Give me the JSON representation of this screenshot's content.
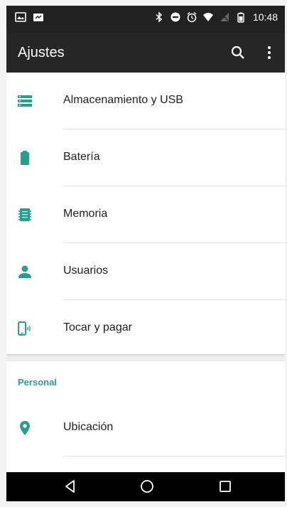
{
  "status_bar": {
    "time": "10:48",
    "left_icons": [
      "gallery-icon",
      "photo-icon"
    ],
    "right_icons": [
      "bluetooth-icon",
      "do-not-disturb-icon",
      "alarm-icon",
      "wifi-icon",
      "no-signal-icon",
      "battery-icon"
    ]
  },
  "toolbar": {
    "title": "Ajustes",
    "search_icon": "search-icon",
    "more_icon": "more-vert-icon"
  },
  "device_section": {
    "items": [
      {
        "label": "Almacenamiento y USB",
        "icon": "storage-icon"
      },
      {
        "label": "Batería",
        "icon": "battery-icon"
      },
      {
        "label": "Memoria",
        "icon": "memory-icon"
      },
      {
        "label": "Usuarios",
        "icon": "person-icon"
      },
      {
        "label": "Tocar y pagar",
        "icon": "nfc-icon"
      }
    ]
  },
  "personal_section": {
    "header": "Personal",
    "items": [
      {
        "label": "Ubicación",
        "icon": "location-pin-icon"
      }
    ]
  },
  "colors": {
    "accent": "#2a9d8f",
    "toolbar": "#262626",
    "status_bar": "#212121",
    "nav_bar": "#000000",
    "text_primary": "#212121"
  },
  "nav_bar": {
    "buttons": [
      "back-icon",
      "home-icon",
      "recents-icon"
    ]
  }
}
